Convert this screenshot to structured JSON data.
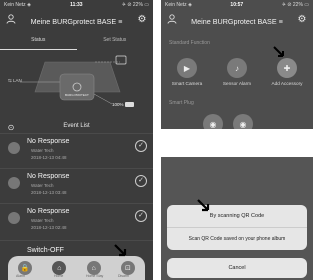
{
  "left": {
    "statusbar": {
      "carrier": "Kein Netz ◈",
      "time": "11:33",
      "right": "✈ ⊘ 22% ▭"
    },
    "header": {
      "title": "Meine BURGprotect BASE ≡"
    },
    "tabs": [
      {
        "label": "Status"
      },
      {
        "label": "Set Status"
      }
    ],
    "diagram": {
      "lan_label": "⇆ LAN",
      "battery": "100%",
      "box_label": "BURG PROTECT"
    },
    "event_list_title": "Event List",
    "events": [
      {
        "title": "No Response",
        "source": "Water Tech",
        "time": "2018-12-13 04:48"
      },
      {
        "title": "No Response",
        "source": "Water Tech",
        "time": "2018-12-13 03:48"
      },
      {
        "title": "No Response",
        "source": "Water Tech",
        "time": "2018-12-13 02:48"
      },
      {
        "title": "Switch-OFF",
        "source": "",
        "time": ""
      }
    ],
    "bottom_labels": [
      "Alarm",
      "Home",
      "Home Stay",
      "Disarm"
    ]
  },
  "right_top": {
    "statusbar": {
      "carrier": "Kein Netz ◈",
      "time": "10:57",
      "right": "✈ ⊘ 22% ▭"
    },
    "header": {
      "title": "Meine BURGprotect BASE ≡"
    },
    "section1": "Standard Function",
    "tiles": [
      {
        "label": "Smart Camera",
        "icon": "camera-icon"
      },
      {
        "label": "Sensor Alarm",
        "icon": "bell-icon"
      },
      {
        "label": "Add Accessory",
        "icon": "shield-plus-icon"
      }
    ],
    "section2": "Smart Plug"
  },
  "right_bottom": {
    "option1": "By scanning QR Code",
    "option2": "Scan QR Code saved on your phone album",
    "cancel": "Cancel"
  }
}
